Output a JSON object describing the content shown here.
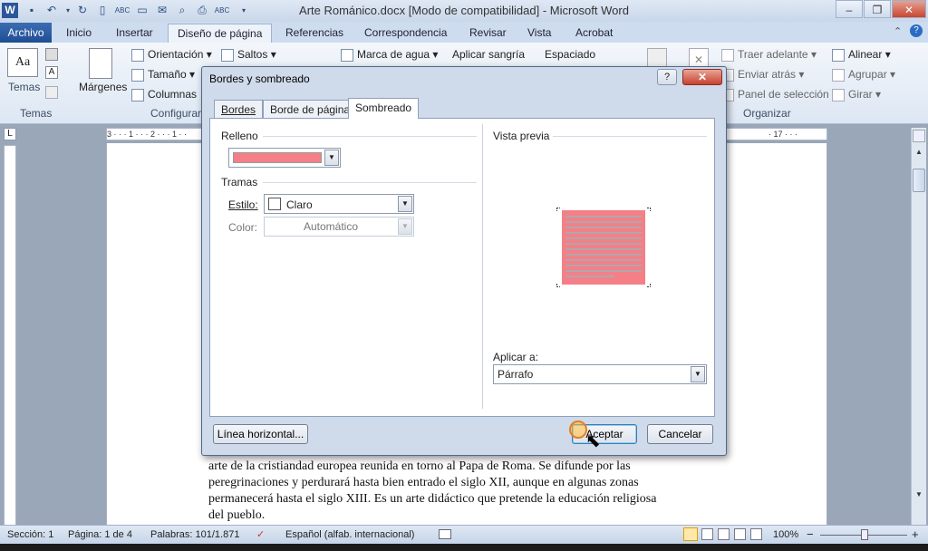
{
  "window": {
    "title": "Arte Románico.docx [Modo de compatibilidad] - Microsoft Word",
    "word_icon": "W",
    "minimize": "–",
    "restore": "❐",
    "close": "✕"
  },
  "tabs": {
    "file": "Archivo",
    "items": [
      "Inicio",
      "Insertar",
      "Diseño de página",
      "Referencias",
      "Correspondencia",
      "Revisar",
      "Vista",
      "Acrobat"
    ],
    "active": "Diseño de página"
  },
  "ribbon": {
    "temas_label": "Temas",
    "temas_group": "Temas",
    "margenes": "Márgenes",
    "orientacion": "Orientación",
    "tamano": "Tamaño",
    "columnas": "Columnas",
    "saltos": "Saltos",
    "configurar_group": "Configurar",
    "marca_agua": "Marca de agua",
    "aplicar_sangria": "Aplicar sangría",
    "espaciado": "Espaciado",
    "traer_adelante": "Traer adelante",
    "enviar_atras": "Enviar atrás",
    "panel_seleccion": "Panel de selección",
    "alinear": "Alinear",
    "agrupar": "Agrupar",
    "girar": "Girar",
    "organizar_group": "Organizar"
  },
  "ruler": {
    "left_marks": "3 · · · 1 · · · 2 · · · 1 · ·",
    "right_marks": "· 17 · · ·"
  },
  "document": {
    "lines": [
      "arte de la cristiandad europea reunida en torno al Papa de Roma. Se difunde por las",
      "peregrinaciones y perdurará hasta bien entrado el siglo XII, aunque en algunas zonas",
      "permanecerá hasta el siglo XIII. Es un arte didáctico que pretende la educación religiosa",
      "del pueblo."
    ]
  },
  "dialog": {
    "title": "Bordes y sombreado",
    "help": "?",
    "close": "✕",
    "tabs": [
      "Bordes",
      "Borde de página",
      "Sombreado"
    ],
    "active_tab": "Sombreado",
    "relleno_label": "Relleno",
    "relleno_color": "#f57f86",
    "tramas_label": "Tramas",
    "estilo_label": "Estilo:",
    "estilo_value": "Claro",
    "color_label": "Color:",
    "color_value": "Automático",
    "vista_previa_label": "Vista previa",
    "aplicar_a_label": "Aplicar a:",
    "aplicar_a_value": "Párrafo",
    "linea_horizontal": "Línea horizontal...",
    "aceptar": "Aceptar",
    "cancelar": "Cancelar"
  },
  "statusbar": {
    "seccion": "Sección: 1",
    "pagina": "Página: 1 de 4",
    "palabras": "Palabras: 101/1.871",
    "idioma": "Español (alfab. internacional)",
    "zoom": "100%",
    "zoom_minus": "−",
    "zoom_plus": "+"
  }
}
